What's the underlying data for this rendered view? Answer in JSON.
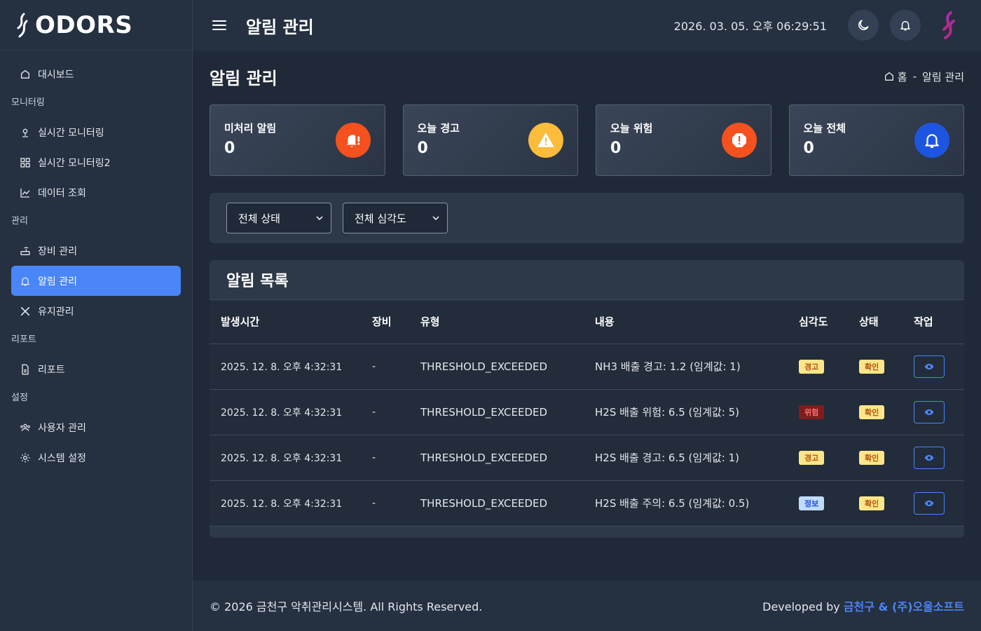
{
  "brand": {
    "name": "ODORS"
  },
  "sidebar": {
    "items": [
      {
        "type": "item",
        "label": "대시보드",
        "icon": "dashboard-icon"
      },
      {
        "type": "section",
        "label": "모니터링"
      },
      {
        "type": "item",
        "label": "실시간 모니터링",
        "icon": "location-pin-icon"
      },
      {
        "type": "item",
        "label": "실시간 모니터링2",
        "icon": "grid-icon"
      },
      {
        "type": "item",
        "label": "데이터 조회",
        "icon": "line-chart-icon"
      },
      {
        "type": "section",
        "label": "관리"
      },
      {
        "type": "item",
        "label": "장비 관리",
        "icon": "router-icon"
      },
      {
        "type": "item",
        "label": "알림 관리",
        "icon": "bell-icon",
        "active": true
      },
      {
        "type": "item",
        "label": "유지관리",
        "icon": "tools-icon"
      },
      {
        "type": "section",
        "label": "리포트"
      },
      {
        "type": "item",
        "label": "리포트",
        "icon": "document-icon"
      },
      {
        "type": "section",
        "label": "설정"
      },
      {
        "type": "item",
        "label": "사용자 관리",
        "icon": "users-icon"
      },
      {
        "type": "item",
        "label": "시스템 설정",
        "icon": "gear-icon"
      }
    ]
  },
  "topbar": {
    "title": "알림 관리",
    "clock": "2026. 03. 05. 오후 06:29:51"
  },
  "page": {
    "title": "알림 관리",
    "breadcrumb": {
      "home": "홈",
      "separator": "-",
      "current": "알림 관리"
    }
  },
  "stats": [
    {
      "label": "미처리 알림",
      "value": "0",
      "icon": "bell-alert-icon",
      "color": "#f4511e"
    },
    {
      "label": "오늘 경고",
      "value": "0",
      "icon": "warning-triangle-icon",
      "color": "#fbbc3c"
    },
    {
      "label": "오늘 위험",
      "value": "0",
      "icon": "danger-octagon-icon",
      "color": "#f4511e"
    },
    {
      "label": "오늘 전체",
      "value": "0",
      "icon": "bell-icon",
      "color": "#1e55e0"
    }
  ],
  "filters": {
    "status": "전체 상태",
    "severity": "전체 심각도"
  },
  "alerts": {
    "title": "알림 목록",
    "columns": [
      "발생시간",
      "장비",
      "유형",
      "내용",
      "심각도",
      "상태",
      "작업"
    ],
    "rows": [
      {
        "time": "2025. 12. 8. 오후 4:32:31",
        "device": "-",
        "type": "THRESHOLD_EXCEEDED",
        "content": "NH3 배출 경고: 1.2 (임계값: 1)",
        "severity": "경고",
        "severity_class": "warn",
        "status": "확인"
      },
      {
        "time": "2025. 12. 8. 오후 4:32:31",
        "device": "-",
        "type": "THRESHOLD_EXCEEDED",
        "content": "H2S 배출 위험: 6.5 (임계값: 5)",
        "severity": "위험",
        "severity_class": "danger",
        "status": "확인"
      },
      {
        "time": "2025. 12. 8. 오후 4:32:31",
        "device": "-",
        "type": "THRESHOLD_EXCEEDED",
        "content": "H2S 배출 경고: 6.5 (임계값: 1)",
        "severity": "경고",
        "severity_class": "warn",
        "status": "확인"
      },
      {
        "time": "2025. 12. 8. 오후 4:32:31",
        "device": "-",
        "type": "THRESHOLD_EXCEEDED",
        "content": "H2S 배출 주의: 6.5 (임계값: 0.5)",
        "severity": "정보",
        "severity_class": "info",
        "status": "확인"
      }
    ]
  },
  "footer": {
    "copyright": "© 2026 금천구 악취관리시스템. All Rights Reserved.",
    "developed_prefix": "Developed by",
    "developer": "금천구 & (주)오울소프트"
  }
}
